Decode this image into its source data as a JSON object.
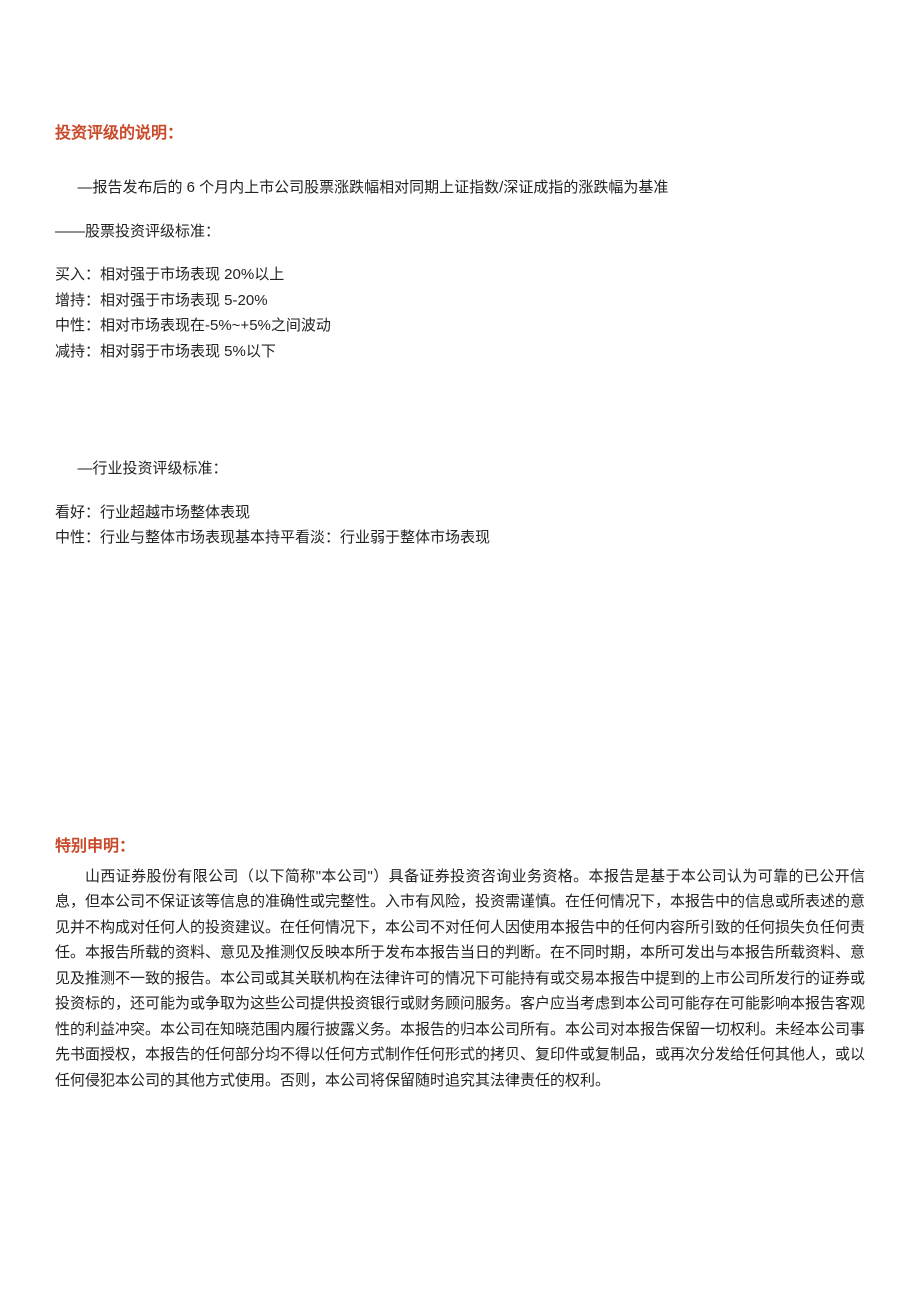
{
  "section1": {
    "heading": "投资评级的说明：",
    "benchmark": "—报告发布后的 6 个月内上市公司股票涨跌幅相对同期上证指数/深证成指的涨跌幅为基准",
    "stock_rating": {
      "title": "——股票投资评级标准：",
      "items": [
        "买入：相对强于市场表现 20%以上",
        "增持：相对强于市场表现 5-20%",
        "中性：相对市场表现在-5%~+5%之间波动",
        "减持：相对弱于市场表现 5%以下"
      ]
    },
    "industry_rating": {
      "title": "—行业投资评级标准：",
      "items": [
        "看好：行业超越市场整体表现",
        "中性：行业与整体市场表现基本持平看淡：行业弱于整体市场表现"
      ]
    }
  },
  "section2": {
    "heading": "特别申明：",
    "body": "山西证券股份有限公司（以下简称\"本公司\"）具备证券投资咨询业务资格。本报告是基于本公司认为可靠的已公开信息，但本公司不保证该等信息的准确性或完整性。入市有风险，投资需谨慎。在任何情况下，本报告中的信息或所表述的意见并不构成对任何人的投资建议。在任何情况下，本公司不对任何人因使用本报告中的任何内容所引致的任何损失负任何责任。本报告所载的资料、意见及推测仅反映本所于发布本报告当日的判断。在不同时期，本所可发出与本报告所载资料、意见及推测不一致的报告。本公司或其关联机构在法律许可的情况下可能持有或交易本报告中提到的上市公司所发行的证券或投资标的，还可能为或争取为这些公司提供投资银行或财务顾问服务。客户应当考虑到本公司可能存在可能影响本报告客观性的利益冲突。本公司在知晓范围内履行披露义务。本报告的归本公司所有。本公司对本报告保留一切权利。未经本公司事先书面授权，本报告的任何部分均不得以任何方式制作任何形式的拷贝、复印件或复制品，或再次分发给任何其他人，或以任何侵犯本公司的其他方式使用。否则，本公司将保留随时追究其法律责任的权利。"
  }
}
